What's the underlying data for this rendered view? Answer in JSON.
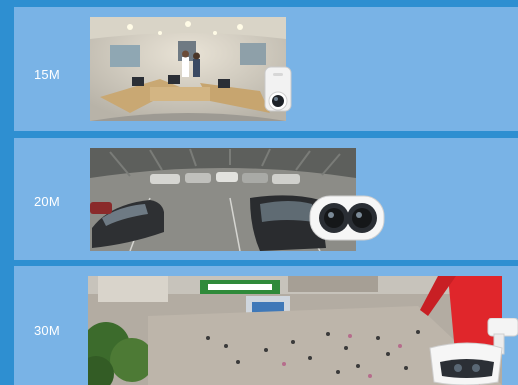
{
  "panels": [
    {
      "resolution": "15M"
    },
    {
      "resolution": "20M"
    },
    {
      "resolution": "30M"
    }
  ],
  "colors": {
    "background": "#2e8fd1",
    "panel": "#79b3e6",
    "text": "#ffffff"
  }
}
